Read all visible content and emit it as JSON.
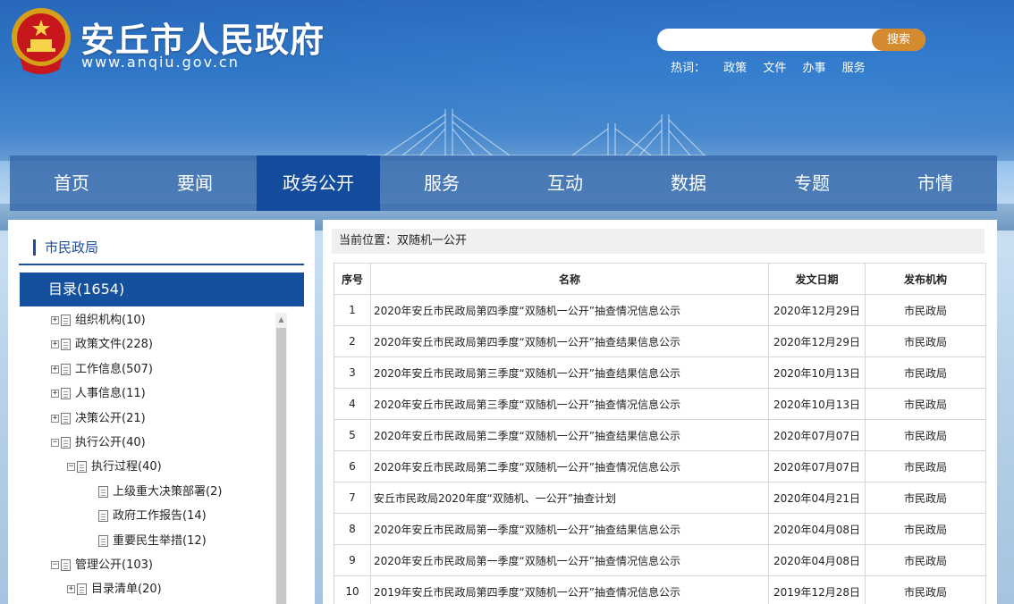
{
  "header": {
    "site_title": "安丘市人民政府",
    "site_url": "www.anqiu.gov.cn",
    "emblem_icon": "national-emblem-icon"
  },
  "search": {
    "placeholder": "",
    "button_label": "搜索",
    "hot_label": "热词：",
    "hot_words": [
      "政策",
      "文件",
      "办事",
      "服务"
    ]
  },
  "nav": {
    "items": [
      "首页",
      "要闻",
      "政务公开",
      "服务",
      "互动",
      "数据",
      "专题",
      "市情"
    ],
    "active_index": 2
  },
  "sidebar": {
    "heading": "市民政局",
    "catalog_label": "目录(1654)",
    "tree": [
      {
        "label": "组织机构(10)",
        "toggle": "+",
        "level": 0
      },
      {
        "label": "政策文件(228)",
        "toggle": "+",
        "level": 0
      },
      {
        "label": "工作信息(507)",
        "toggle": "+",
        "level": 0
      },
      {
        "label": "人事信息(11)",
        "toggle": "+",
        "level": 0
      },
      {
        "label": "决策公开(21)",
        "toggle": "+",
        "level": 0
      },
      {
        "label": "执行公开(40)",
        "toggle": "−",
        "level": 0
      },
      {
        "label": "执行过程(40)",
        "toggle": "−",
        "level": 1
      },
      {
        "label": "上级重大决策部署(2)",
        "toggle": "",
        "level": 2
      },
      {
        "label": "政府工作报告(14)",
        "toggle": "",
        "level": 2
      },
      {
        "label": "重要民生举措(12)",
        "toggle": "",
        "level": 2
      },
      {
        "label": "管理公开(103)",
        "toggle": "−",
        "level": 0
      },
      {
        "label": "目录清单(20)",
        "toggle": "+",
        "level": 1
      }
    ]
  },
  "main": {
    "location": "当前位置：双随机一公开",
    "columns": [
      "序号",
      "名称",
      "发文日期",
      "发布机构"
    ],
    "rows": [
      [
        "1",
        "2020年安丘市民政局第四季度“双随机一公开”抽查情况信息公示",
        "2020年12月29日",
        "市民政局"
      ],
      [
        "2",
        "2020年安丘市民政局第四季度“双随机一公开”抽查结果信息公示",
        "2020年12月29日",
        "市民政局"
      ],
      [
        "3",
        "2020年安丘市民政局第三季度“双随机一公开”抽查结果信息公示",
        "2020年10月13日",
        "市民政局"
      ],
      [
        "4",
        "2020年安丘市民政局第三季度“双随机一公开”抽查情况信息公示",
        "2020年10月13日",
        "市民政局"
      ],
      [
        "5",
        "2020年安丘市民政局第二季度“双随机一公开”抽查结果信息公示",
        "2020年07月07日",
        "市民政局"
      ],
      [
        "6",
        "2020年安丘市民政局第二季度“双随机一公开”抽查情况信息公示",
        "2020年07月07日",
        "市民政局"
      ],
      [
        "7",
        "安丘市民政局2020年度“双随机、一公开”抽查计划",
        "2020年04月21日",
        "市民政局"
      ],
      [
        "8",
        "2020年安丘市民政局第一季度“双随机一公开”抽查结果信息公示",
        "2020年04月08日",
        "市民政局"
      ],
      [
        "9",
        "2020年安丘市民政局第一季度“双随机一公开”抽查情况信息公示",
        "2020年04月08日",
        "市民政局"
      ],
      [
        "10",
        "2019年安丘市民政局第四季度“双随机一公开”抽查情况信息公示",
        "2019年12月28日",
        "市民政局"
      ]
    ]
  }
}
